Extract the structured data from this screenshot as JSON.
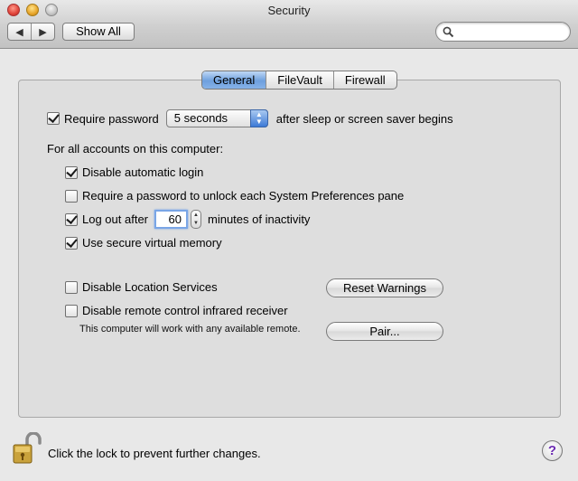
{
  "window": {
    "title": "Security"
  },
  "toolbar": {
    "back_glyph": "◀",
    "forward_glyph": "▶",
    "show_all_label": "Show All",
    "search_value": "",
    "search_placeholder": ""
  },
  "tabs": [
    {
      "label": "General",
      "selected": true
    },
    {
      "label": "FileVault",
      "selected": false
    },
    {
      "label": "Firewall",
      "selected": false
    }
  ],
  "general": {
    "require_password": {
      "label": "Require password",
      "checked": true,
      "delay_selected": "5 seconds",
      "suffix": "after sleep or screen saver begins"
    },
    "all_accounts_heading": "For all accounts on this computer:",
    "options": [
      {
        "label": "Disable automatic login",
        "checked": true
      },
      {
        "label": "Require a password to unlock each System Preferences pane",
        "checked": false
      },
      {
        "label": "Log out after",
        "checked": true
      },
      {
        "label": "Use secure virtual memory",
        "checked": true
      }
    ],
    "logout_minutes": "60",
    "logout_suffix": "minutes of inactivity",
    "location_services": {
      "label": "Disable Location Services",
      "checked": false
    },
    "reset_warnings_label": "Reset Warnings",
    "infrared": {
      "label": "Disable remote control infrared receiver",
      "checked": false,
      "note": "This computer will work with any available remote."
    },
    "pair_label": "Pair..."
  },
  "footer": {
    "lock_label": "Click the lock to prevent further changes.",
    "help_label": "?"
  },
  "colors": {
    "tab_selected": "#6ea0de",
    "help_question": "#6c2bb2",
    "lock_gold": "#c9a23c"
  }
}
